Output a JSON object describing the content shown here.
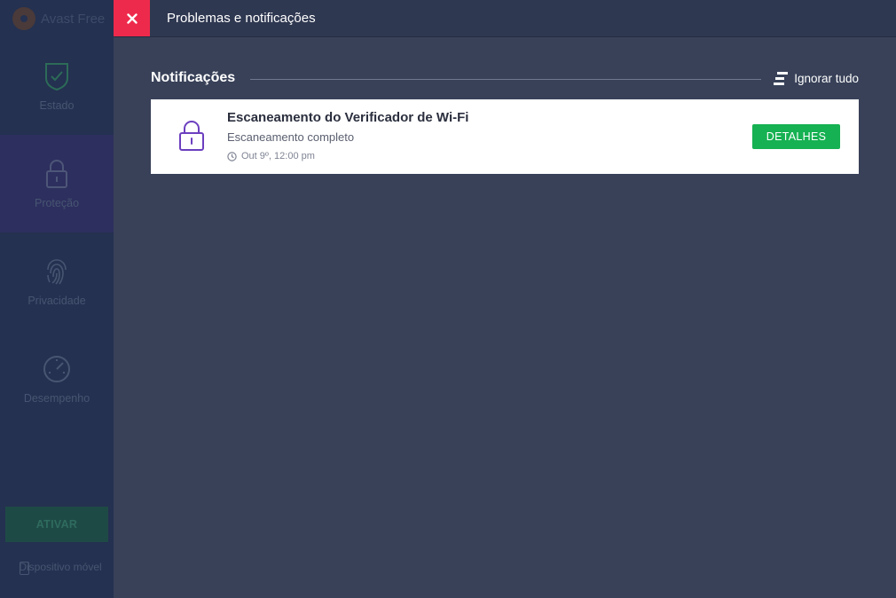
{
  "sidebar": {
    "brand": "Avast Free",
    "items": [
      {
        "label": "Estado",
        "icon": "shield-check-icon"
      },
      {
        "label": "Proteção",
        "icon": "lock-icon"
      },
      {
        "label": "Privacidade",
        "icon": "fingerprint-icon"
      },
      {
        "label": "Desempenho",
        "icon": "gauge-icon"
      }
    ],
    "activate_label": "ATIVAR",
    "mobile_label": "Dispositivo móvel"
  },
  "panel": {
    "title": "Problemas e notificações",
    "section_title": "Notificações",
    "ignore_all_label": "Ignorar tudo",
    "notification": {
      "title": "Escaneamento do Verificador de Wi-Fi",
      "subtitle": "Escaneamento completo",
      "time": "Out 9º, 12:00 pm",
      "button_label": "DETALHES",
      "icon": "lock-icon"
    }
  },
  "colors": {
    "close": "#ee2a4c",
    "accent_button": "#16b152",
    "panel_bg": "#384158",
    "icon_purple": "#6c3fbf"
  }
}
